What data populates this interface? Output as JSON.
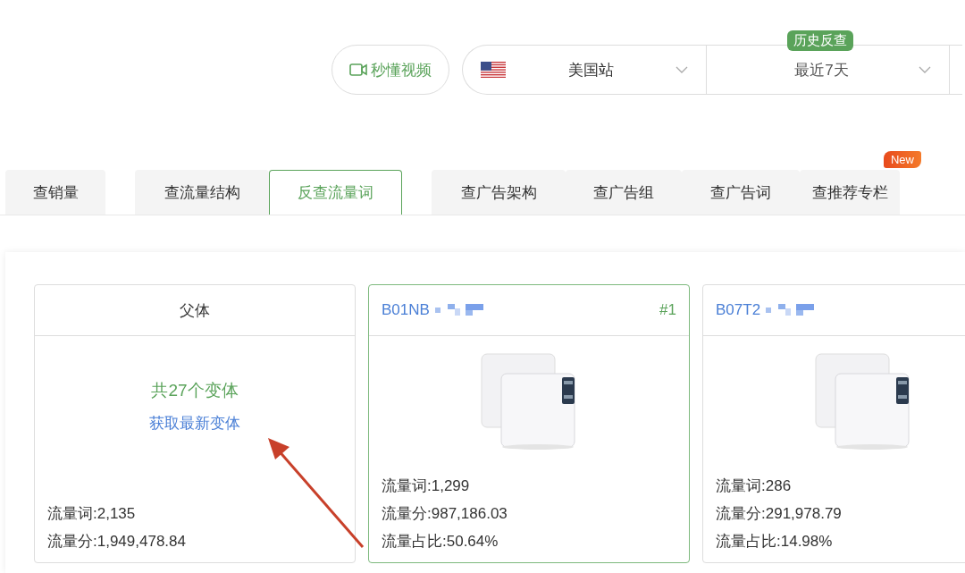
{
  "header": {
    "video_button": "秒懂视频",
    "site": {
      "label": "美国站"
    },
    "period": {
      "badge": "历史反查",
      "label": "最近7天"
    }
  },
  "tabs": [
    {
      "label": "查销量",
      "selected": false
    },
    {
      "label": "查流量结构",
      "selected": false
    },
    {
      "label": "反查流量词",
      "selected": true
    },
    {
      "label": "查广告架构",
      "selected": false
    },
    {
      "label": "查广告组",
      "selected": false
    },
    {
      "label": "查广告词",
      "selected": false
    },
    {
      "label": "查推荐专栏",
      "selected": false,
      "badge": "New"
    }
  ],
  "cards": [
    {
      "kind": "parent",
      "title": "父体",
      "variant_count": "共27个变体",
      "link": "获取最新变体",
      "selected": false,
      "stats": [
        "流量词:2,135",
        "流量分:1,949,478.84"
      ]
    },
    {
      "kind": "variant",
      "asin": "B01NB",
      "rank": "#1",
      "selected": true,
      "stats": [
        "流量词:1,299",
        "流量分:987,186.03",
        "流量占比:50.64%"
      ]
    },
    {
      "kind": "variant",
      "asin": "B07T2",
      "selected": false,
      "stats": [
        "流量词:286",
        "流量分:291,978.79",
        "流量占比:14.98%"
      ]
    }
  ]
}
